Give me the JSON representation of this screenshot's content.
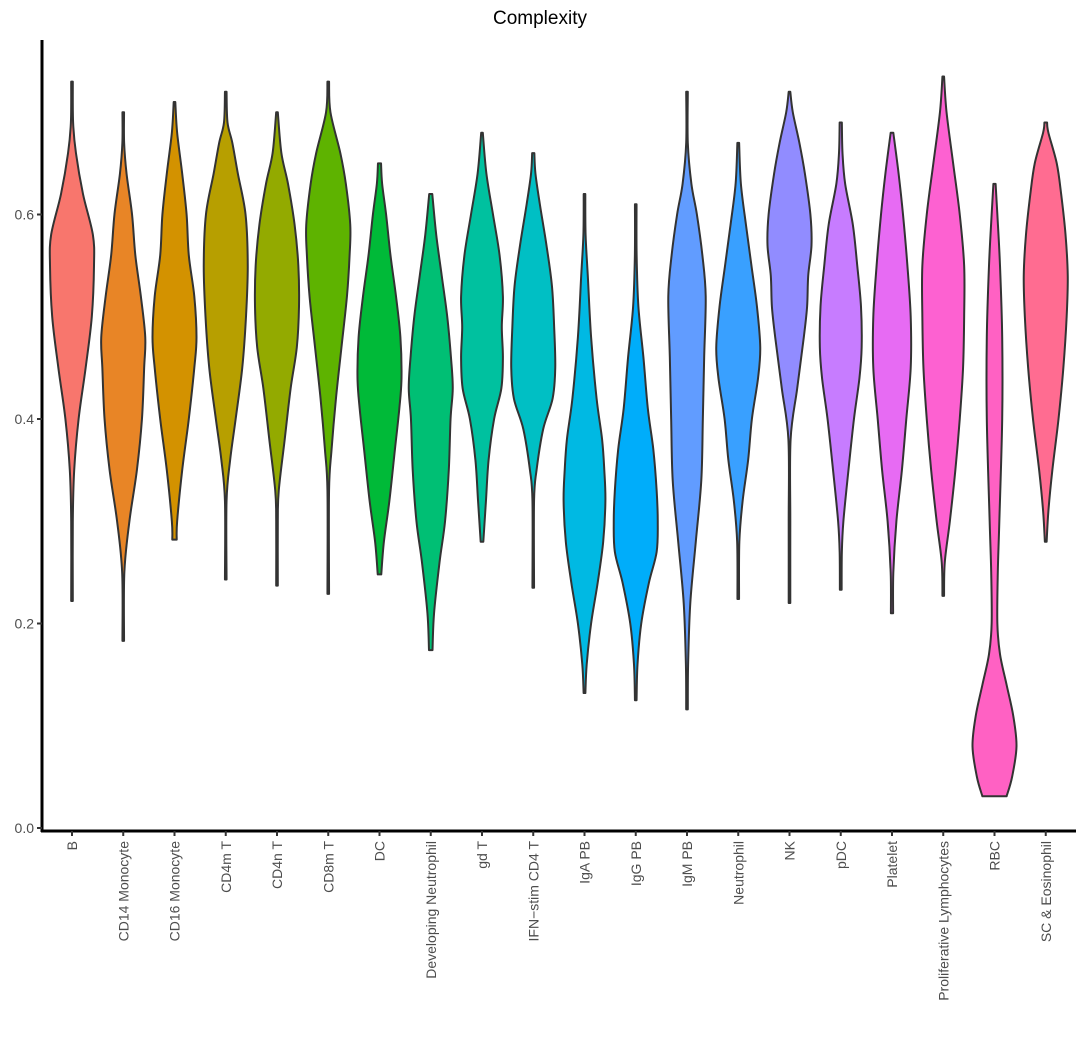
{
  "chart_data": {
    "type": "violin",
    "title": "Complexity",
    "xlabel": "",
    "ylabel": "",
    "ylim": [
      0.0,
      0.78
    ],
    "yticks": [
      "0.0",
      "0.2",
      "0.4",
      "0.6"
    ],
    "ytick_values": [
      0.0,
      0.2,
      0.4,
      0.6
    ],
    "grid": false,
    "legend": "none",
    "categories": [
      "B",
      "CD14 Monocyte",
      "CD16 Monocyte",
      "CD4m T",
      "CD4n T",
      "CD8m T",
      "DC",
      "Developing Neutrophil",
      "gd T",
      "IFN−stim CD4 T",
      "IgA PB",
      "IgG PB",
      "IgM PB",
      "Neutrophil",
      "NK",
      "pDC",
      "Platelet",
      "Proliferative Lymphocytes",
      "RBC",
      "SC & Eosinophil"
    ],
    "colors": [
      "#F8766D",
      "#E88526",
      "#D39200",
      "#B79F00",
      "#93AA00",
      "#5EB300",
      "#00BA38",
      "#00BF74",
      "#00C19F",
      "#00BFC4",
      "#00B9E3",
      "#00ADFA",
      "#619CFF",
      "#39A0FF",
      "#918CFF",
      "#C77CFF",
      "#E76BF3",
      "#FD61D1",
      "#FF61C3",
      "#FF6C91"
    ],
    "series": [
      {
        "name": "B",
        "min": 0.222,
        "max": 0.73,
        "density": [
          [
            0.222,
            0.01
          ],
          [
            0.3,
            0.02
          ],
          [
            0.35,
            0.1
          ],
          [
            0.4,
            0.3
          ],
          [
            0.45,
            0.62
          ],
          [
            0.5,
            0.9
          ],
          [
            0.55,
            1.0
          ],
          [
            0.58,
            0.95
          ],
          [
            0.62,
            0.5
          ],
          [
            0.66,
            0.18
          ],
          [
            0.69,
            0.05
          ],
          [
            0.73,
            0.01
          ]
        ]
      },
      {
        "name": "CD14 Monocyte",
        "min": 0.183,
        "max": 0.7,
        "density": [
          [
            0.183,
            0.01
          ],
          [
            0.25,
            0.05
          ],
          [
            0.3,
            0.28
          ],
          [
            0.35,
            0.62
          ],
          [
            0.4,
            0.85
          ],
          [
            0.45,
            0.95
          ],
          [
            0.48,
            1.0
          ],
          [
            0.52,
            0.8
          ],
          [
            0.56,
            0.55
          ],
          [
            0.6,
            0.4
          ],
          [
            0.64,
            0.15
          ],
          [
            0.67,
            0.04
          ],
          [
            0.7,
            0.01
          ]
        ]
      },
      {
        "name": "CD16 Monocyte",
        "min": 0.282,
        "max": 0.71,
        "density": [
          [
            0.282,
            0.1
          ],
          [
            0.3,
            0.12
          ],
          [
            0.35,
            0.35
          ],
          [
            0.4,
            0.65
          ],
          [
            0.45,
            0.9
          ],
          [
            0.48,
            1.0
          ],
          [
            0.52,
            0.9
          ],
          [
            0.56,
            0.65
          ],
          [
            0.6,
            0.55
          ],
          [
            0.64,
            0.35
          ],
          [
            0.68,
            0.12
          ],
          [
            0.71,
            0.01
          ]
        ]
      },
      {
        "name": "CD4m T",
        "min": 0.243,
        "max": 0.72,
        "density": [
          [
            0.243,
            0.01
          ],
          [
            0.32,
            0.03
          ],
          [
            0.36,
            0.2
          ],
          [
            0.4,
            0.45
          ],
          [
            0.45,
            0.75
          ],
          [
            0.5,
            0.92
          ],
          [
            0.55,
            1.0
          ],
          [
            0.6,
            0.9
          ],
          [
            0.64,
            0.55
          ],
          [
            0.67,
            0.3
          ],
          [
            0.69,
            0.08
          ],
          [
            0.72,
            0.01
          ]
        ]
      },
      {
        "name": "CD4n T",
        "min": 0.237,
        "max": 0.7,
        "density": [
          [
            0.237,
            0.01
          ],
          [
            0.3,
            0.02
          ],
          [
            0.33,
            0.08
          ],
          [
            0.38,
            0.35
          ],
          [
            0.43,
            0.62
          ],
          [
            0.47,
            0.9
          ],
          [
            0.51,
            1.0
          ],
          [
            0.55,
            0.97
          ],
          [
            0.59,
            0.8
          ],
          [
            0.63,
            0.5
          ],
          [
            0.66,
            0.2
          ],
          [
            0.7,
            0.01
          ]
        ]
      },
      {
        "name": "CD8m T",
        "min": 0.229,
        "max": 0.73,
        "density": [
          [
            0.229,
            0.01
          ],
          [
            0.33,
            0.02
          ],
          [
            0.37,
            0.15
          ],
          [
            0.42,
            0.35
          ],
          [
            0.47,
            0.6
          ],
          [
            0.52,
            0.85
          ],
          [
            0.56,
            0.97
          ],
          [
            0.59,
            1.0
          ],
          [
            0.63,
            0.8
          ],
          [
            0.66,
            0.55
          ],
          [
            0.7,
            0.1
          ],
          [
            0.73,
            0.01
          ]
        ]
      },
      {
        "name": "DC",
        "min": 0.248,
        "max": 0.65,
        "density": [
          [
            0.248,
            0.08
          ],
          [
            0.28,
            0.2
          ],
          [
            0.32,
            0.45
          ],
          [
            0.37,
            0.7
          ],
          [
            0.41,
            0.9
          ],
          [
            0.44,
            1.0
          ],
          [
            0.48,
            0.95
          ],
          [
            0.52,
            0.75
          ],
          [
            0.56,
            0.5
          ],
          [
            0.6,
            0.3
          ],
          [
            0.63,
            0.12
          ],
          [
            0.65,
            0.07
          ]
        ]
      },
      {
        "name": "Developing Neutrophil",
        "min": 0.174,
        "max": 0.62,
        "density": [
          [
            0.174,
            0.08
          ],
          [
            0.21,
            0.15
          ],
          [
            0.26,
            0.4
          ],
          [
            0.3,
            0.65
          ],
          [
            0.35,
            0.82
          ],
          [
            0.4,
            0.9
          ],
          [
            0.43,
            1.0
          ],
          [
            0.46,
            0.92
          ],
          [
            0.5,
            0.75
          ],
          [
            0.54,
            0.5
          ],
          [
            0.58,
            0.25
          ],
          [
            0.62,
            0.07
          ]
        ]
      },
      {
        "name": "gd T",
        "min": 0.28,
        "max": 0.68,
        "density": [
          [
            0.28,
            0.06
          ],
          [
            0.32,
            0.18
          ],
          [
            0.36,
            0.3
          ],
          [
            0.4,
            0.55
          ],
          [
            0.43,
            0.88
          ],
          [
            0.46,
            0.95
          ],
          [
            0.49,
            0.9
          ],
          [
            0.52,
            0.95
          ],
          [
            0.56,
            0.8
          ],
          [
            0.6,
            0.5
          ],
          [
            0.64,
            0.2
          ],
          [
            0.68,
            0.01
          ]
        ]
      },
      {
        "name": "IFN−stim CD4 T",
        "min": 0.235,
        "max": 0.66,
        "density": [
          [
            0.235,
            0.01
          ],
          [
            0.32,
            0.03
          ],
          [
            0.35,
            0.15
          ],
          [
            0.39,
            0.45
          ],
          [
            0.42,
            0.88
          ],
          [
            0.45,
            1.0
          ],
          [
            0.49,
            0.95
          ],
          [
            0.53,
            0.85
          ],
          [
            0.57,
            0.6
          ],
          [
            0.61,
            0.3
          ],
          [
            0.64,
            0.1
          ],
          [
            0.66,
            0.05
          ]
        ]
      },
      {
        "name": "IgA PB",
        "min": 0.132,
        "max": 0.62,
        "density": [
          [
            0.132,
            0.04
          ],
          [
            0.16,
            0.1
          ],
          [
            0.2,
            0.3
          ],
          [
            0.24,
            0.6
          ],
          [
            0.28,
            0.85
          ],
          [
            0.32,
            0.95
          ],
          [
            0.35,
            0.9
          ],
          [
            0.38,
            0.8
          ],
          [
            0.42,
            0.55
          ],
          [
            0.48,
            0.3
          ],
          [
            0.54,
            0.15
          ],
          [
            0.58,
            0.05
          ],
          [
            0.62,
            0.03
          ]
        ]
      },
      {
        "name": "IgG PB",
        "min": 0.125,
        "max": 0.61,
        "density": [
          [
            0.125,
            0.03
          ],
          [
            0.16,
            0.08
          ],
          [
            0.2,
            0.25
          ],
          [
            0.24,
            0.6
          ],
          [
            0.27,
            0.95
          ],
          [
            0.3,
            1.0
          ],
          [
            0.33,
            0.95
          ],
          [
            0.37,
            0.8
          ],
          [
            0.41,
            0.55
          ],
          [
            0.46,
            0.35
          ],
          [
            0.51,
            0.12
          ],
          [
            0.56,
            0.04
          ],
          [
            0.61,
            0.01
          ]
        ]
      },
      {
        "name": "IgM PB",
        "min": 0.116,
        "max": 0.72,
        "density": [
          [
            0.116,
            0.02
          ],
          [
            0.16,
            0.05
          ],
          [
            0.22,
            0.15
          ],
          [
            0.28,
            0.4
          ],
          [
            0.34,
            0.65
          ],
          [
            0.4,
            0.72
          ],
          [
            0.46,
            0.78
          ],
          [
            0.52,
            0.85
          ],
          [
            0.56,
            0.7
          ],
          [
            0.6,
            0.45
          ],
          [
            0.63,
            0.2
          ],
          [
            0.67,
            0.03
          ],
          [
            0.72,
            0.01
          ]
        ]
      },
      {
        "name": "Neutrophil",
        "min": 0.224,
        "max": 0.67,
        "density": [
          [
            0.224,
            0.03
          ],
          [
            0.28,
            0.05
          ],
          [
            0.32,
            0.2
          ],
          [
            0.36,
            0.45
          ],
          [
            0.4,
            0.62
          ],
          [
            0.44,
            0.9
          ],
          [
            0.47,
            1.0
          ],
          [
            0.51,
            0.85
          ],
          [
            0.55,
            0.6
          ],
          [
            0.59,
            0.35
          ],
          [
            0.63,
            0.12
          ],
          [
            0.67,
            0.04
          ]
        ]
      },
      {
        "name": "NK",
        "min": 0.22,
        "max": 0.72,
        "density": [
          [
            0.22,
            0.01
          ],
          [
            0.3,
            0.02
          ],
          [
            0.38,
            0.05
          ],
          [
            0.43,
            0.35
          ],
          [
            0.48,
            0.65
          ],
          [
            0.51,
            0.8
          ],
          [
            0.54,
            0.85
          ],
          [
            0.57,
            1.0
          ],
          [
            0.6,
            0.95
          ],
          [
            0.64,
            0.7
          ],
          [
            0.67,
            0.45
          ],
          [
            0.7,
            0.15
          ],
          [
            0.72,
            0.01
          ]
        ]
      },
      {
        "name": "pDC",
        "min": 0.233,
        "max": 0.69,
        "density": [
          [
            0.233,
            0.04
          ],
          [
            0.27,
            0.05
          ],
          [
            0.3,
            0.12
          ],
          [
            0.35,
            0.35
          ],
          [
            0.4,
            0.6
          ],
          [
            0.44,
            0.85
          ],
          [
            0.47,
            0.95
          ],
          [
            0.51,
            0.92
          ],
          [
            0.55,
            0.75
          ],
          [
            0.59,
            0.55
          ],
          [
            0.63,
            0.2
          ],
          [
            0.66,
            0.08
          ],
          [
            0.69,
            0.05
          ]
        ]
      },
      {
        "name": "Platelet",
        "min": 0.21,
        "max": 0.68,
        "density": [
          [
            0.21,
            0.05
          ],
          [
            0.25,
            0.06
          ],
          [
            0.3,
            0.2
          ],
          [
            0.35,
            0.45
          ],
          [
            0.4,
            0.65
          ],
          [
            0.45,
            0.85
          ],
          [
            0.5,
            0.85
          ],
          [
            0.55,
            0.7
          ],
          [
            0.6,
            0.5
          ],
          [
            0.64,
            0.3
          ],
          [
            0.68,
            0.06
          ]
        ]
      },
      {
        "name": "Proliferative Lymphocytes",
        "min": 0.227,
        "max": 0.735,
        "density": [
          [
            0.227,
            0.03
          ],
          [
            0.26,
            0.07
          ],
          [
            0.3,
            0.3
          ],
          [
            0.35,
            0.55
          ],
          [
            0.4,
            0.75
          ],
          [
            0.45,
            0.9
          ],
          [
            0.5,
            0.95
          ],
          [
            0.55,
            0.95
          ],
          [
            0.6,
            0.75
          ],
          [
            0.65,
            0.45
          ],
          [
            0.7,
            0.15
          ],
          [
            0.735,
            0.01
          ]
        ]
      },
      {
        "name": "RBC",
        "min": 0.031,
        "max": 0.63,
        "density": [
          [
            0.031,
            0.55
          ],
          [
            0.05,
            0.8
          ],
          [
            0.08,
            1.0
          ],
          [
            0.11,
            0.85
          ],
          [
            0.14,
            0.55
          ],
          [
            0.17,
            0.25
          ],
          [
            0.2,
            0.13
          ],
          [
            0.25,
            0.15
          ],
          [
            0.3,
            0.22
          ],
          [
            0.4,
            0.35
          ],
          [
            0.48,
            0.35
          ],
          [
            0.55,
            0.25
          ],
          [
            0.6,
            0.13
          ],
          [
            0.63,
            0.05
          ]
        ]
      },
      {
        "name": "SC & Eosinophil",
        "min": 0.28,
        "max": 0.69,
        "density": [
          [
            0.28,
            0.04
          ],
          [
            0.31,
            0.12
          ],
          [
            0.35,
            0.3
          ],
          [
            0.4,
            0.58
          ],
          [
            0.45,
            0.8
          ],
          [
            0.5,
            0.95
          ],
          [
            0.54,
            1.0
          ],
          [
            0.58,
            0.9
          ],
          [
            0.62,
            0.7
          ],
          [
            0.65,
            0.5
          ],
          [
            0.68,
            0.12
          ],
          [
            0.69,
            0.06
          ]
        ]
      }
    ]
  }
}
